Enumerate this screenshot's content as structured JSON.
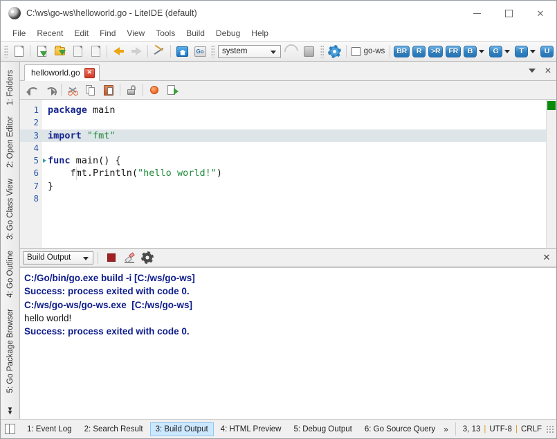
{
  "window": {
    "title": "C:\\ws\\go-ws\\helloworld.go - LiteIDE (default)",
    "app_icon": "liteide-logo-icon",
    "minimize_label": "—",
    "maximize_label": "❐",
    "close_label": "✕"
  },
  "menubar": {
    "items": [
      {
        "label": "File"
      },
      {
        "label": "Recent"
      },
      {
        "label": "Edit"
      },
      {
        "label": "Find"
      },
      {
        "label": "View"
      },
      {
        "label": "Tools"
      },
      {
        "label": "Build"
      },
      {
        "label": "Debug"
      },
      {
        "label": "Help"
      }
    ]
  },
  "toolbar": {
    "new_file": "new-file-icon",
    "open_file": "open-file-icon",
    "open_folder": "open-folder-icon",
    "save_file": "save-file-icon",
    "save_all": "save-all-icon",
    "nav_back": "navigate-back-icon",
    "nav_forward": "navigate-forward-icon",
    "tools": "tools-icon",
    "home": "home-icon",
    "go_doc": "go-doc-icon",
    "env_combo_value": "system",
    "sync_icon": "sync-icon",
    "stop_icon": "stop-icon",
    "settings_icon": "settings-gear-icon",
    "project_checkbox_label": "go-ws",
    "project_checkbox_checked": false,
    "badges": [
      {
        "label": "BR",
        "name": "build-and-run-button",
        "dropdown": false
      },
      {
        "label": "R",
        "name": "run-button",
        "dropdown": false
      },
      {
        "label": ">R",
        "name": "run-with-args-button",
        "dropdown": false
      },
      {
        "label": "FR",
        "name": "file-run-button",
        "dropdown": false
      },
      {
        "label": "B",
        "name": "build-button",
        "dropdown": true
      },
      {
        "label": "G",
        "name": "go-tool-button",
        "dropdown": true
      },
      {
        "label": "T",
        "name": "test-button",
        "dropdown": true
      },
      {
        "label": "U",
        "name": "update-button",
        "dropdown": false
      }
    ]
  },
  "sidebar": {
    "tabs": [
      {
        "label": "1: Folders",
        "name": "sidebar-tab-folders"
      },
      {
        "label": "2: Open Editor",
        "name": "sidebar-tab-open-editor"
      },
      {
        "label": "3: Go Class View",
        "name": "sidebar-tab-go-class-view"
      },
      {
        "label": "4: Go Outline",
        "name": "sidebar-tab-go-outline"
      },
      {
        "label": "5: Go Package Browser",
        "name": "sidebar-tab-go-package-browser"
      }
    ],
    "more_label": "»"
  },
  "editor": {
    "tab_label": "helloworld.go",
    "tab_close_label": "✕",
    "tabstrip_menu_icon": "chevron-down-icon",
    "tabstrip_close_label": "✕",
    "toolbar": {
      "undo": "undo-icon",
      "redo": "redo-icon",
      "cut": "cut-scissors-icon",
      "copy": "copy-icon",
      "paste": "paste-icon",
      "lock": "lock-open-icon",
      "bookmark": "bookmark-dot-icon",
      "goto": "goto-definition-icon"
    },
    "line_numbers": [
      "1",
      "2",
      "3",
      "4",
      "5",
      "6",
      "7",
      "8"
    ],
    "highlighted_line": 3,
    "fold_line": 5,
    "code_lines": [
      {
        "n": 1,
        "tokens": [
          {
            "t": "kw",
            "s": "package"
          },
          {
            "t": "pl",
            "s": " main"
          }
        ]
      },
      {
        "n": 2,
        "tokens": [
          {
            "t": "pl",
            "s": ""
          }
        ]
      },
      {
        "n": 3,
        "tokens": [
          {
            "t": "kw",
            "s": "import"
          },
          {
            "t": "pl",
            "s": " "
          },
          {
            "t": "str",
            "s": "\"fmt\""
          }
        ]
      },
      {
        "n": 4,
        "tokens": [
          {
            "t": "pl",
            "s": ""
          }
        ]
      },
      {
        "n": 5,
        "tokens": [
          {
            "t": "kw",
            "s": "func"
          },
          {
            "t": "pl",
            "s": " main() {"
          }
        ]
      },
      {
        "n": 6,
        "tokens": [
          {
            "t": "pl",
            "s": "    fmt.Println("
          },
          {
            "t": "str",
            "s": "\"hello world!\""
          },
          {
            "t": "pl",
            "s": ")"
          }
        ]
      },
      {
        "n": 7,
        "tokens": [
          {
            "t": "pl",
            "s": "}"
          }
        ]
      },
      {
        "n": 8,
        "tokens": [
          {
            "t": "pl",
            "s": ""
          }
        ]
      }
    ],
    "marker_color": "#0a8a0a"
  },
  "output": {
    "combo_value": "Build Output",
    "stop_icon": "stop-process-icon",
    "clear_icon": "clear-output-icon",
    "config_icon": "output-settings-gear-icon",
    "close_label": "✕",
    "lines": [
      {
        "text": "C:/Go/bin/go.exe build -i [C:/ws/go-ws]",
        "bold": true
      },
      {
        "text": "Success: process exited with code 0.",
        "bold": true
      },
      {
        "text": "C:/ws/go-ws/go-ws.exe  [C:/ws/go-ws]",
        "bold": true
      },
      {
        "text": "hello world!",
        "bold": false
      },
      {
        "text": "Success: process exited with code 0.",
        "bold": true
      }
    ]
  },
  "statusbar": {
    "toggle_icon": "toggle-sidebar-icon",
    "tabs": [
      {
        "label": "1: Event Log",
        "active": false,
        "name": "status-tab-event-log"
      },
      {
        "label": "2: Search Result",
        "active": false,
        "name": "status-tab-search-result"
      },
      {
        "label": "3: Build Output",
        "active": true,
        "name": "status-tab-build-output"
      },
      {
        "label": "4: HTML Preview",
        "active": false,
        "name": "status-tab-html-preview"
      },
      {
        "label": "5: Debug Output",
        "active": false,
        "name": "status-tab-debug-output"
      },
      {
        "label": "6: Go Source Query",
        "active": false,
        "name": "status-tab-go-source-query"
      }
    ],
    "more_label": "»",
    "cursor_position": "3, 13",
    "encoding": "UTF-8",
    "line_ending": "CRLF",
    "separator": "|"
  },
  "colors": {
    "accent_blue": "#2f83c6",
    "keyword": "#17258f",
    "string": "#1f8a3a",
    "output_text": "#0d1c8c",
    "highlight_line": "#dde5e8",
    "active_tab": "#cce8ff"
  }
}
